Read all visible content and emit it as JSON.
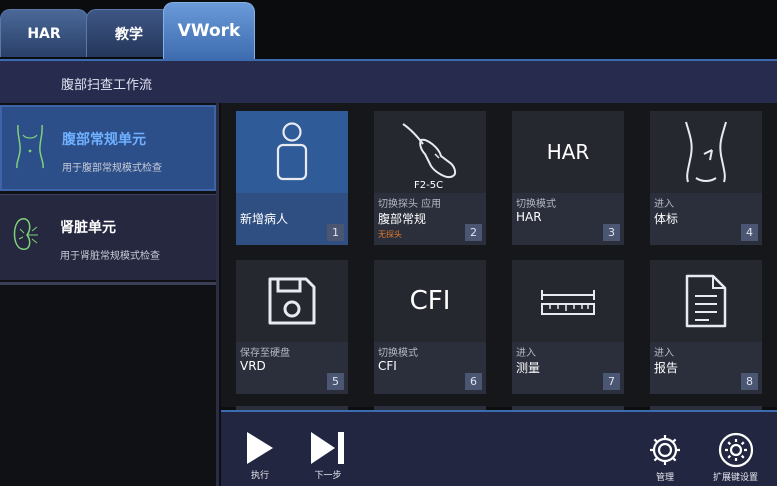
{
  "tabs": [
    {
      "label": "HAR"
    },
    {
      "label": "教学"
    },
    {
      "label": "VWork"
    }
  ],
  "header": {
    "title": "腹部扫查工作流"
  },
  "sidebar": {
    "units": [
      {
        "name": "腹部常规单元",
        "desc": "用于腹部常规模式检查"
      },
      {
        "name": "肾脏单元",
        "desc": "用于肾脏常规模式检查"
      }
    ]
  },
  "cards": [
    {
      "sub": "",
      "label": "新增病人",
      "num": "1"
    },
    {
      "icon_text": "F2-5C",
      "sub": "切换探头 应用",
      "label": "腹部常规",
      "warn": "无探头",
      "num": "2"
    },
    {
      "icon_text": "HAR",
      "sub": "切换模式",
      "label": "HAR",
      "num": "3"
    },
    {
      "sub": "进入",
      "label": "体标",
      "num": "4"
    },
    {
      "sub": "保存至硬盘",
      "label": "VRD",
      "num": "5"
    },
    {
      "icon_text": "CFI",
      "sub": "切换模式",
      "label": "CFI",
      "num": "6"
    },
    {
      "sub": "进入",
      "label": "测量",
      "num": "7"
    },
    {
      "sub": "进入",
      "label": "报告",
      "num": "8"
    }
  ],
  "bottom": {
    "execute": "执行",
    "next": "下一步",
    "manage": "管理",
    "extkey": "扩展键设置"
  },
  "colors": {
    "accent": "#3d6bb0",
    "selected_text": "#6fb0ff",
    "warning": "#e07a2a"
  }
}
